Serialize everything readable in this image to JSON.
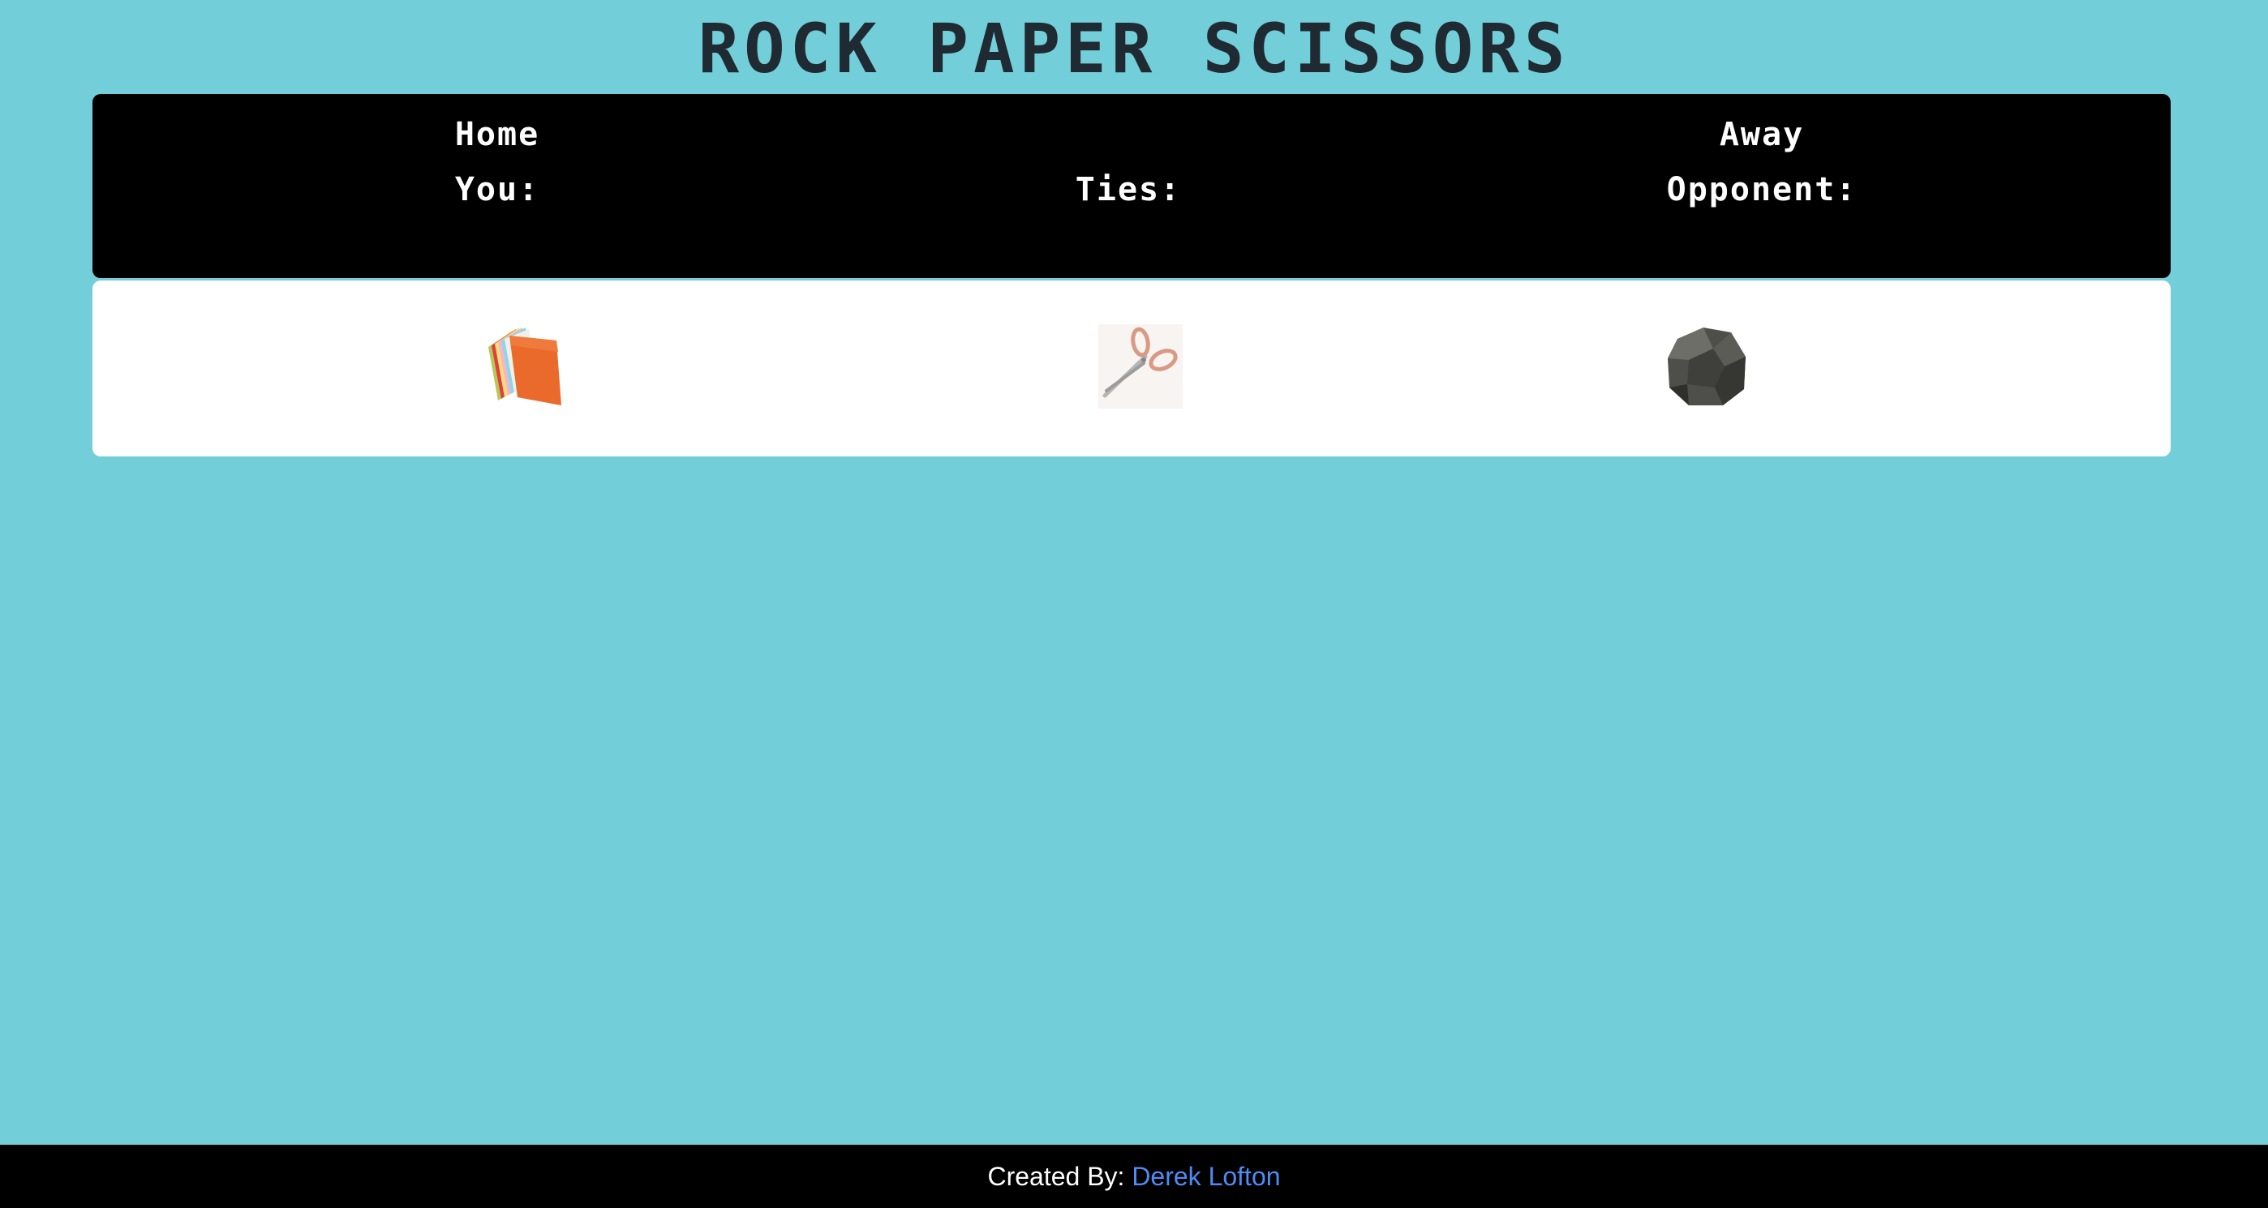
{
  "title": "ROCK PAPER SCISSORS",
  "scoreboard": {
    "home_heading": "Home",
    "you_label": "You:",
    "ties_label": "Ties:",
    "away_heading": "Away",
    "opponent_label": "Opponent:"
  },
  "choices": [
    {
      "name": "paper",
      "icon": "paper-icon"
    },
    {
      "name": "scissors",
      "icon": "scissors-icon"
    },
    {
      "name": "rock",
      "icon": "rock-icon"
    }
  ],
  "footer": {
    "created_by_label": "Created By:",
    "author_name": "Derek Lofton"
  },
  "colors": {
    "background": "#72ced9",
    "title": "#1f2a33",
    "scoreboard_bg": "#000000",
    "panel_bg": "#ffffff",
    "link": "#4f8bf5"
  }
}
